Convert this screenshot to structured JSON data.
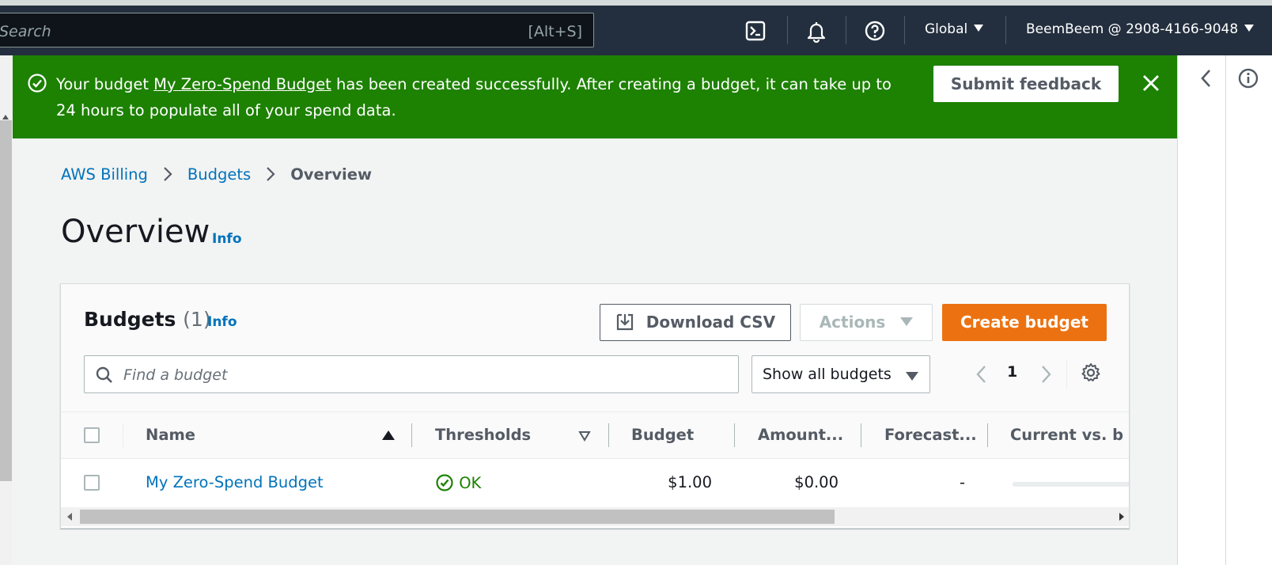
{
  "topbar": {
    "search_placeholder": "Search",
    "search_shortcut": "[Alt+S]",
    "region": "Global",
    "account": "BeemBeem @ 2908-4166-9048"
  },
  "flash": {
    "prefix": "Your budget ",
    "budget_link": "My Zero-Spend Budget",
    "suffix": " has been created successfully. After creating a budget, it can take up to 24 hours to populate all of your spend data.",
    "feedback_button": "Submit feedback"
  },
  "breadcrumb": {
    "items": [
      "AWS Billing",
      "Budgets"
    ],
    "current": "Overview"
  },
  "page": {
    "title": "Overview",
    "info": "Info"
  },
  "budgets": {
    "title": "Budgets",
    "count": "(1)",
    "info": "Info",
    "download_button": "Download CSV",
    "actions_button": "Actions",
    "create_button": "Create budget",
    "search_placeholder": "Find a budget",
    "filter_value": "Show all budgets",
    "page": "1",
    "columns": [
      "Name",
      "Thresholds",
      "Budget",
      "Amount...",
      "Forecast...",
      "Current vs. b"
    ],
    "rows": [
      {
        "name": "My Zero-Spend Budget",
        "threshold": "OK",
        "budget": "$1.00",
        "amount": "$0.00",
        "forecast": "-"
      }
    ]
  },
  "colors": {
    "topbar": "#232f3e",
    "success": "#1d8102",
    "link": "#0073bb",
    "primary": "#ec7211"
  }
}
